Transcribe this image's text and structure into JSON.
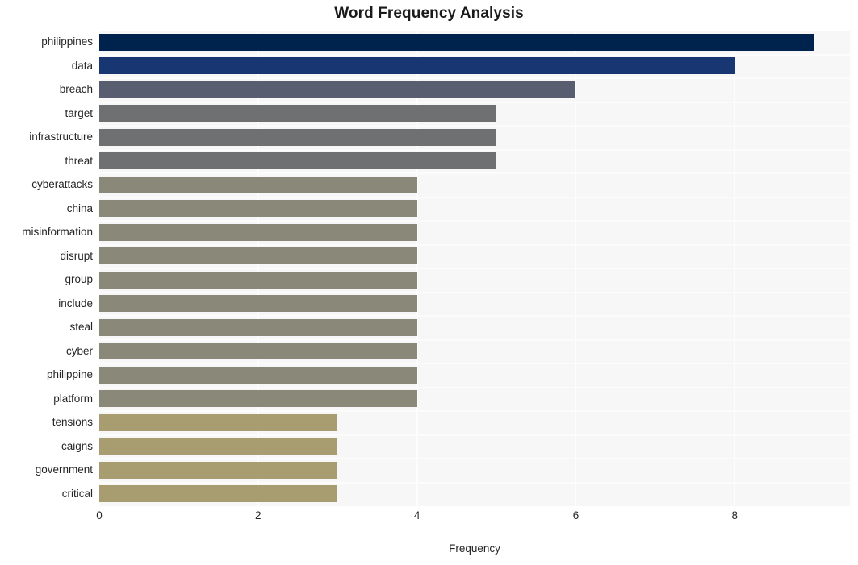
{
  "chart_data": {
    "type": "bar",
    "orientation": "horizontal",
    "title": "Word Frequency Analysis",
    "xlabel": "Frequency",
    "ylabel": "",
    "xlim": [
      0,
      9.45
    ],
    "xticks": [
      0,
      2,
      4,
      6,
      8
    ],
    "xtick_labels": [
      "0",
      "2",
      "4",
      "6",
      "8"
    ],
    "grid": true,
    "legend": "none",
    "categories": [
      "philippines",
      "data",
      "breach",
      "target",
      "infrastructure",
      "threat",
      "cyberattacks",
      "china",
      "misinformation",
      "disrupt",
      "group",
      "include",
      "steal",
      "cyber",
      "philippine",
      "platform",
      "tensions",
      "caigns",
      "government",
      "critical"
    ],
    "values": [
      9,
      8,
      6,
      5,
      5,
      5,
      4,
      4,
      4,
      4,
      4,
      4,
      4,
      4,
      4,
      4,
      3,
      3,
      3,
      3
    ],
    "bar_colors": [
      "#00234d",
      "#173672",
      "#585d70",
      "#6e7072",
      "#6e7072",
      "#6e7072",
      "#8a8878",
      "#8a8878",
      "#8a8878",
      "#8a8878",
      "#8a8878",
      "#8a8878",
      "#8a8878",
      "#8a8878",
      "#8a8878",
      "#8a8878",
      "#a89d71",
      "#a89d71",
      "#a89d71",
      "#a89d71"
    ],
    "plot_background": "#f7f7f8",
    "figure_background": "#ffffff",
    "gridline_color": "#fdfdfd"
  }
}
